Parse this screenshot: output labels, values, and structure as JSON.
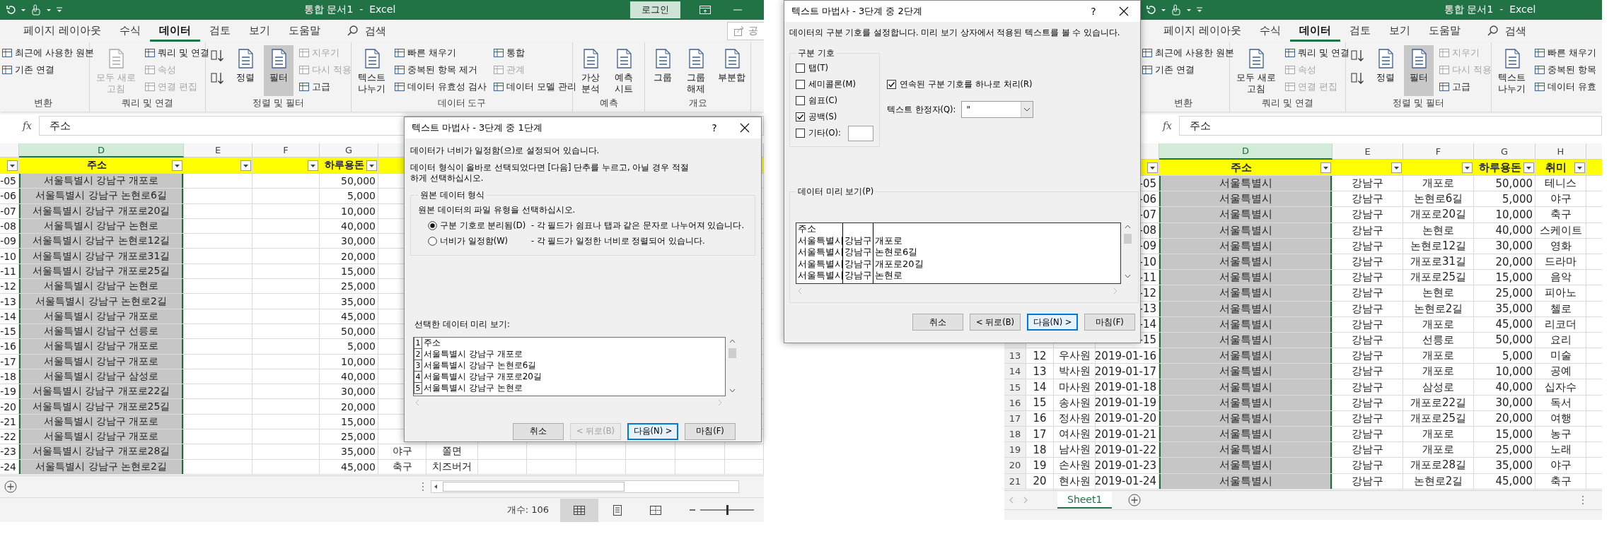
{
  "left_window": {
    "title": "통합 문서1  -  Excel",
    "login_button": "로그인",
    "tabs": [
      {
        "label": "페이지 레이아웃",
        "selected": false
      },
      {
        "label": "수식",
        "selected": false
      },
      {
        "label": "데이터",
        "selected": true
      },
      {
        "label": "검토",
        "selected": false
      },
      {
        "label": "보기",
        "selected": false
      },
      {
        "label": "도움말",
        "selected": false
      }
    ],
    "search": "검색",
    "share_button": "공",
    "ribbon": [
      {
        "label": "변환",
        "items": [
          {
            "kind": "small",
            "label": "최근에 사용한 원본",
            "disabled": false
          },
          {
            "kind": "small",
            "label": "기존 연결",
            "disabled": false
          }
        ]
      },
      {
        "label": "쿼리 및 연결",
        "items": [
          {
            "kind": "large",
            "label": "모두 새로 고침",
            "disabled": true,
            "pressed": false
          },
          {
            "kind": "small",
            "label": "쿼리 및 연결",
            "disabled": false
          },
          {
            "kind": "small",
            "label": "속성",
            "disabled": true
          },
          {
            "kind": "small",
            "label": "연결 편집",
            "disabled": true
          }
        ]
      },
      {
        "label": "정렬 및 필터",
        "items": [
          {
            "kind": "icon",
            "disabled": false
          },
          {
            "kind": "icon",
            "disabled": false
          },
          {
            "kind": "large",
            "label": "정렬",
            "disabled": false,
            "pressed": false
          },
          {
            "kind": "large",
            "label": "필터",
            "disabled": false,
            "pressed": true
          },
          {
            "kind": "small",
            "label": "지우기",
            "disabled": true
          },
          {
            "kind": "small",
            "label": "다시 적용",
            "disabled": true
          },
          {
            "kind": "small",
            "label": "고급",
            "disabled": false
          }
        ]
      },
      {
        "label": "데이터 도구",
        "items": [
          {
            "kind": "large",
            "label": "텍스트 나누기",
            "disabled": false,
            "pressed": false
          },
          {
            "kind": "small",
            "label": "빠른 채우기",
            "disabled": false
          },
          {
            "kind": "small",
            "label": "중복된 항목 제거",
            "disabled": false
          },
          {
            "kind": "small",
            "label": "데이터 유효성 검사",
            "disabled": false
          },
          {
            "kind": "small",
            "label": "통합",
            "disabled": false
          },
          {
            "kind": "small",
            "label": "관계",
            "disabled": true
          },
          {
            "kind": "small",
            "label": "데이터 모델 관리",
            "disabled": false
          }
        ]
      },
      {
        "label": "예측",
        "items": [
          {
            "kind": "large",
            "label": "가상 분석",
            "disabled": false,
            "pressed": false
          },
          {
            "kind": "large",
            "label": "예측 시트",
            "disabled": false,
            "pressed": false
          }
        ]
      },
      {
        "label": "개요",
        "items": [
          {
            "kind": "large",
            "label": "그룹",
            "disabled": false,
            "pressed": false
          },
          {
            "kind": "large",
            "label": "그룹 해제",
            "disabled": false,
            "pressed": false
          },
          {
            "kind": "large",
            "label": "부분합",
            "disabled": false,
            "pressed": false
          }
        ]
      }
    ],
    "function_button": "fx",
    "formula": "주소",
    "column_letters": {
      "D": {
        "label": "D",
        "selected": true
      },
      "E": {
        "label": "E",
        "selected": false
      },
      "F": {
        "label": "F",
        "selected": false
      },
      "G": {
        "label": "G",
        "selected": false
      }
    },
    "header_row": {
      "C": {
        "filter": true
      },
      "D": {
        "text": "주소",
        "filter": true
      },
      "E": {
        "filter": true
      },
      "F": {
        "filter": true
      },
      "G": {
        "text": "하루용돈",
        "filter": true
      }
    },
    "rows": [
      {
        "C": "-05",
        "D": "서울특별시 강남구 개포로",
        "G": "50,000"
      },
      {
        "C": "-06",
        "D": "서울특별시 강남구 논현로6길",
        "G": "5,000"
      },
      {
        "C": "-07",
        "D": "서울특별시 강남구 개포로20길",
        "G": "10,000"
      },
      {
        "C": "-08",
        "D": "서울특별시 강남구 논현로",
        "G": "40,000"
      },
      {
        "C": "-09",
        "D": "서울특별시 강남구 논현로12길",
        "G": "30,000"
      },
      {
        "C": "-10",
        "D": "서울특별시 강남구 개포로31길",
        "G": "20,000"
      },
      {
        "C": "-11",
        "D": "서울특별시 강남구 개포로25길",
        "G": "15,000"
      },
      {
        "C": "-12",
        "D": "서울특별시 강남구 논현로",
        "G": "25,000"
      },
      {
        "C": "-13",
        "D": "서울특별시 강남구 논현로2길",
        "G": "35,000"
      },
      {
        "C": "-14",
        "D": "서울특별시 강남구 개포로",
        "G": "45,000"
      },
      {
        "C": "-15",
        "D": "서울특별시 강남구 선릉로",
        "G": "50,000"
      },
      {
        "C": "-16",
        "D": "서울특별시 강남구 개포로",
        "G": "5,000"
      },
      {
        "C": "-17",
        "D": "서울특별시 강남구 개포로",
        "G": "10,000"
      },
      {
        "C": "-18",
        "D": "서울특별시 강남구 삼성로",
        "G": "40,000"
      },
      {
        "C": "-19",
        "D": "서울특별시 강남구 개포로22길",
        "G": "30,000"
      },
      {
        "C": "-20",
        "D": "서울특별시 강남구 개포로25길",
        "G": "20,000"
      },
      {
        "C": "-21",
        "D": "서울특별시 강남구 개포로",
        "G": "15,000"
      },
      {
        "C": "-22",
        "D": "서울특별시 강남구 개포로",
        "G": "25,000"
      },
      {
        "C": "-23",
        "D": "서울특별시 강남구 개포로28길",
        "G": "35,000",
        "H": "야구",
        "I": "쫄면"
      },
      {
        "C": "-24",
        "D": "서울특별시 강남구 논현로2길",
        "G": "45,000",
        "H": "축구",
        "I": "치즈버거"
      }
    ],
    "status": {
      "count": "개수: 106",
      "views": [
        {
          "selected": true
        },
        {
          "selected": false
        },
        {
          "selected": false
        }
      ],
      "zoom_slider": {
        "level": 0.5
      }
    }
  },
  "text_wizard_step1": {
    "title": "텍스트 마법사 - 3단계 중 1단계",
    "help_button": "?",
    "description": "데이터가 너비가 일정함(으)로 설정되어 있습니다.",
    "instruction": "데이터 형식이 올바로 선택되었다면 [다음] 단추를 누르고, 아닐 경우 적절하게 선택하십시오.",
    "group_label": "원본 데이터 형식",
    "group_prompt": "원본 데이터의 파일 유형을 선택하십시오.",
    "options": [
      {
        "label": "구분 기호로 분리됨(D)",
        "description": "- 각 필드가 쉼표나 탭과 같은 문자로 나누어져 있습니다.",
        "selected": true
      },
      {
        "label": "너비가 일정함(W)",
        "description": "- 각 필드가 일정한 너비로 정렬되어 있습니다.",
        "selected": false
      }
    ],
    "preview_label": "선택한 데이터 미리 보기:",
    "preview_lines": [
      {
        "number": "1",
        "text": "주소"
      },
      {
        "number": "2",
        "text": "서울특별시 강남구 개포로"
      },
      {
        "number": "3",
        "text": "서울특별시 강남구 논현로6길"
      },
      {
        "number": "4",
        "text": "서울특별시 강남구 개포로20길"
      },
      {
        "number": "5",
        "text": "서울특별시 강남구 논현로"
      }
    ],
    "buttons": [
      {
        "label": "취소",
        "disabled": false,
        "default": false
      },
      {
        "label": "< 뒤로(B)",
        "disabled": true,
        "default": false
      },
      {
        "label": "다음(N) >",
        "disabled": false,
        "default": true
      },
      {
        "label": "마침(F)",
        "disabled": false,
        "default": false
      }
    ]
  },
  "text_wizard_step2": {
    "title": "텍스트 마법사 - 3단계 중 2단계",
    "help_button": "?",
    "description": "데이터의 구분 기호를 설정합니다. 미리 보기 상자에서 적용된 텍스트를 볼 수 있습니다.",
    "delimiter_group_label": "구분 기호",
    "delimiters": [
      {
        "kind": "plain",
        "label": "탭(T)",
        "checked": false
      },
      {
        "kind": "plain",
        "label": "세미콜론(M)",
        "checked": false
      },
      {
        "kind": "plain",
        "label": "쉼표(C)",
        "checked": false
      },
      {
        "kind": "plain",
        "label": "공백(S)",
        "checked": true
      },
      {
        "kind": "other",
        "label": "기타(O):",
        "checked": false
      }
    ],
    "consecutive_delimiters": {
      "label": "연속된 구분 기호를 하나로 처리(R)",
      "checked": true
    },
    "text_qualifier": {
      "label": "텍스트 한정자(Q):",
      "value": "\""
    },
    "preview_label": "데이터 미리 보기(P)",
    "preview_rows": [
      [
        "주소"
      ],
      [
        "서울특별시",
        "강남구",
        "개포로"
      ],
      [
        "서울특별시",
        "강남구",
        "논현로6길"
      ],
      [
        "서울특별시",
        "강남구",
        "개포로20길"
      ],
      [
        "서울특별시",
        "강남구",
        "논현로"
      ]
    ],
    "buttons": [
      {
        "label": "취소",
        "disabled": false,
        "default": false
      },
      {
        "label": "< 뒤로(B)",
        "disabled": false,
        "default": false
      },
      {
        "label": "다음(N) >",
        "disabled": false,
        "default": true
      },
      {
        "label": "마침(F)",
        "disabled": false,
        "default": false
      }
    ]
  },
  "right_window": {
    "title": "통합 문서1  -  Excel",
    "tabs": [
      {
        "label": "페이지 레이아웃",
        "selected": false
      },
      {
        "label": "수식",
        "selected": false
      },
      {
        "label": "데이터",
        "selected": true
      },
      {
        "label": "검토",
        "selected": false
      },
      {
        "label": "보기",
        "selected": false
      },
      {
        "label": "도움말",
        "selected": false
      }
    ],
    "search": "검색",
    "ribbon": [
      {
        "label": "변환",
        "items": [
          {
            "kind": "small",
            "label": "최근에 사용한 원본",
            "disabled": false
          },
          {
            "kind": "small",
            "label": "기존 연결",
            "disabled": false
          }
        ]
      },
      {
        "label": "쿼리 및 연결",
        "items": [
          {
            "kind": "large",
            "label": "모두 새로 고침",
            "disabled": false,
            "pressed": false
          },
          {
            "kind": "small",
            "label": "쿼리 및 연결",
            "disabled": false
          },
          {
            "kind": "small",
            "label": "속성",
            "disabled": true
          },
          {
            "kind": "small",
            "label": "연결 편집",
            "disabled": true
          }
        ]
      },
      {
        "label": "정렬 및 필터",
        "items": [
          {
            "kind": "icon",
            "disabled": false
          },
          {
            "kind": "icon",
            "disabled": false
          },
          {
            "kind": "large",
            "label": "정렬",
            "disabled": false,
            "pressed": false
          },
          {
            "kind": "large",
            "label": "필터",
            "disabled": false,
            "pressed": true
          },
          {
            "kind": "small",
            "label": "지우기",
            "disabled": true
          },
          {
            "kind": "small",
            "label": "다시 적용",
            "disabled": true
          },
          {
            "kind": "small",
            "label": "고급",
            "disabled": false
          }
        ]
      },
      {
        "items": [
          {
            "kind": "large",
            "label": "텍스트 나누기",
            "disabled": false,
            "pressed": false
          },
          {
            "kind": "small",
            "label": "빠른 채우기",
            "disabled": false
          },
          {
            "kind": "small",
            "label": "중복된 항목",
            "disabled": false
          },
          {
            "kind": "small",
            "label": "데이터 유효",
            "disabled": false
          }
        ]
      }
    ],
    "function_button": "fx",
    "formula": "주소",
    "column_letters": {
      "D": {
        "label": "D",
        "selected": true
      },
      "E": {
        "label": "E",
        "selected": false
      },
      "F": {
        "label": "F",
        "selected": false
      },
      "G": {
        "label": "G",
        "selected": false
      },
      "H": {
        "label": "H",
        "selected": false
      }
    },
    "header_row": {
      "C": {
        "filter": true
      },
      "D": {
        "text": "주소",
        "filter": true
      },
      "E": {
        "filter": true
      },
      "F": {
        "filter": true
      },
      "G": {
        "text": "하루용돈",
        "filter": true
      },
      "H": {
        "text": "취미",
        "filter": true
      }
    },
    "rows": [
      {
        "C": "-05",
        "D": "서울특별시",
        "E": "강남구",
        "F": "개포로",
        "G": "50,000",
        "H": "테니스"
      },
      {
        "C": "-06",
        "D": "서울특별시",
        "E": "강남구",
        "F": "논현로6길",
        "G": "5,000",
        "H": "야구"
      },
      {
        "C": "-07",
        "D": "서울특별시",
        "E": "강남구",
        "F": "개포로20길",
        "G": "10,000",
        "H": "축구"
      },
      {
        "C": "-08",
        "D": "서울특별시",
        "E": "강남구",
        "F": "논현로",
        "G": "40,000",
        "H": "스케이트"
      },
      {
        "C": "-09",
        "D": "서울특별시",
        "E": "강남구",
        "F": "논현로12길",
        "G": "30,000",
        "H": "영화"
      },
      {
        "C": "-10",
        "D": "서울특별시",
        "E": "강남구",
        "F": "개포로31길",
        "G": "20,000",
        "H": "드라마"
      },
      {
        "C": "-11",
        "D": "서울특별시",
        "E": "강남구",
        "F": "개포로25길",
        "G": "15,000",
        "H": "음악"
      },
      {
        "C": "-12",
        "D": "서울특별시",
        "E": "강남구",
        "F": "논현로",
        "G": "25,000",
        "H": "피아노"
      },
      {
        "C": "-13",
        "D": "서울특별시",
        "E": "강남구",
        "F": "논현로2길",
        "G": "35,000",
        "H": "첼로"
      },
      {
        "C": "-14",
        "D": "서울특별시",
        "E": "강남구",
        "F": "개포로",
        "G": "45,000",
        "H": "리코더"
      },
      {
        "C": "-15",
        "D": "서울특별시",
        "E": "강남구",
        "F": "선릉로",
        "G": "50,000",
        "H": "요리"
      },
      {
        "row_number": "13",
        "A": "12",
        "B": "우사원",
        "C": "2019-01-16",
        "D": "서울특별시",
        "E": "강남구",
        "F": "개포로",
        "G": "5,000",
        "H": "미술"
      },
      {
        "row_number": "14",
        "A": "13",
        "B": "박사원",
        "C": "2019-01-17",
        "D": "서울특별시",
        "E": "강남구",
        "F": "개포로",
        "G": "10,000",
        "H": "공예"
      },
      {
        "row_number": "15",
        "A": "14",
        "B": "마사원",
        "C": "2019-01-18",
        "D": "서울특별시",
        "E": "강남구",
        "F": "삼성로",
        "G": "40,000",
        "H": "십자수"
      },
      {
        "row_number": "16",
        "A": "15",
        "B": "송사원",
        "C": "2019-01-19",
        "D": "서울특별시",
        "E": "강남구",
        "F": "개포로22길",
        "G": "30,000",
        "H": "독서"
      },
      {
        "row_number": "17",
        "A": "16",
        "B": "정사원",
        "C": "2019-01-20",
        "D": "서울특별시",
        "E": "강남구",
        "F": "개포로25길",
        "G": "20,000",
        "H": "여행"
      },
      {
        "row_number": "18",
        "A": "17",
        "B": "여사원",
        "C": "2019-01-21",
        "D": "서울특별시",
        "E": "강남구",
        "F": "개포로",
        "G": "15,000",
        "H": "농구"
      },
      {
        "row_number": "19",
        "A": "18",
        "B": "남사원",
        "C": "2019-01-22",
        "D": "서울특별시",
        "E": "강남구",
        "F": "개포로",
        "G": "25,000",
        "H": "노래"
      },
      {
        "row_number": "20",
        "A": "19",
        "B": "손사원",
        "C": "2019-01-23",
        "D": "서울특별시",
        "E": "강남구",
        "F": "개포로28길",
        "G": "35,000",
        "H": "야구"
      },
      {
        "row_number": "21",
        "A": "20",
        "B": "현사원",
        "C": "2019-01-24",
        "D": "서울특별시",
        "E": "강남구",
        "F": "논현로2길",
        "G": "45,000",
        "H": "축구"
      }
    ],
    "sheet_tabs": [
      {
        "label": "Sheet1",
        "selected": true
      }
    ]
  }
}
